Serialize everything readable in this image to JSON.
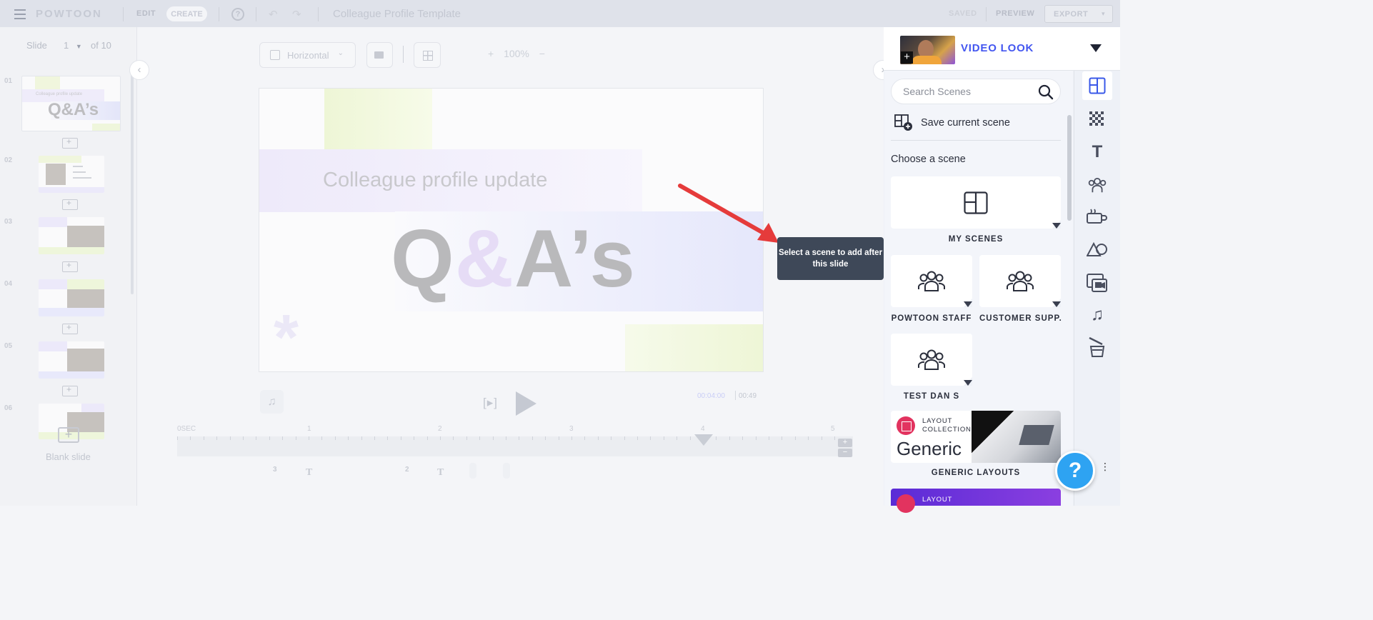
{
  "topbar": {
    "logo": "POWTOON",
    "edit": "EDIT",
    "create": "CREATE",
    "help": "?",
    "undo": "↶",
    "redo": "↷",
    "title": "Colleague Profile Template",
    "saved": "SAVED",
    "preview": "PREVIEW",
    "export": "EXPORT",
    "export_caret": "▾"
  },
  "slides_panel": {
    "slide_label": "Slide",
    "current": "1",
    "of_label": "of 10",
    "thumb_numbers": [
      "01",
      "02",
      "03",
      "04",
      "05",
      "06"
    ],
    "thumb_01_title": "Colleague profile update",
    "thumb_01_big": "Q&A’s",
    "blank_slide": "Blank slide"
  },
  "stage": {
    "orientation": "Horizontal",
    "zoom": "100%",
    "zoom_plus": "+",
    "zoom_minus": "−",
    "canvas_title": "Colleague profile update",
    "canvas_big_q": "Q",
    "canvas_big_amp": "&",
    "canvas_big_rest": "A’s",
    "canvas_asterisk": "*"
  },
  "tooltip": {
    "text": "Select a scene to add after this slide"
  },
  "timeline": {
    "music_icon": "♫",
    "play_bracket": "[▸]",
    "current_time": "00:04:00",
    "total_time": "00:49",
    "ruler_labels": [
      "0SEC",
      "1",
      "2",
      "3",
      "4",
      "5"
    ],
    "zoom_in": "+",
    "zoom_out": "−",
    "track_items": [
      "3",
      "T",
      "2",
      "T"
    ]
  },
  "right_panel": {
    "title": "VIDEO LOOK",
    "search_placeholder": "Search Scenes",
    "save_current_scene": "Save current scene",
    "choose_scene": "Choose a scene",
    "scenes": [
      {
        "label": "MY SCENES"
      },
      {
        "label": "POWTOON STAFF"
      },
      {
        "label": "CUSTOMER SUPP..."
      },
      {
        "label": "TEST DAN S"
      }
    ],
    "generic_collection": "LAYOUT\nCOLLECTION",
    "generic_title": "Generic",
    "generic_label": "GENERIC LAYOUTS",
    "layout_card2": "LAYOUT",
    "help_fab": "?",
    "help_dots": "⋮"
  }
}
